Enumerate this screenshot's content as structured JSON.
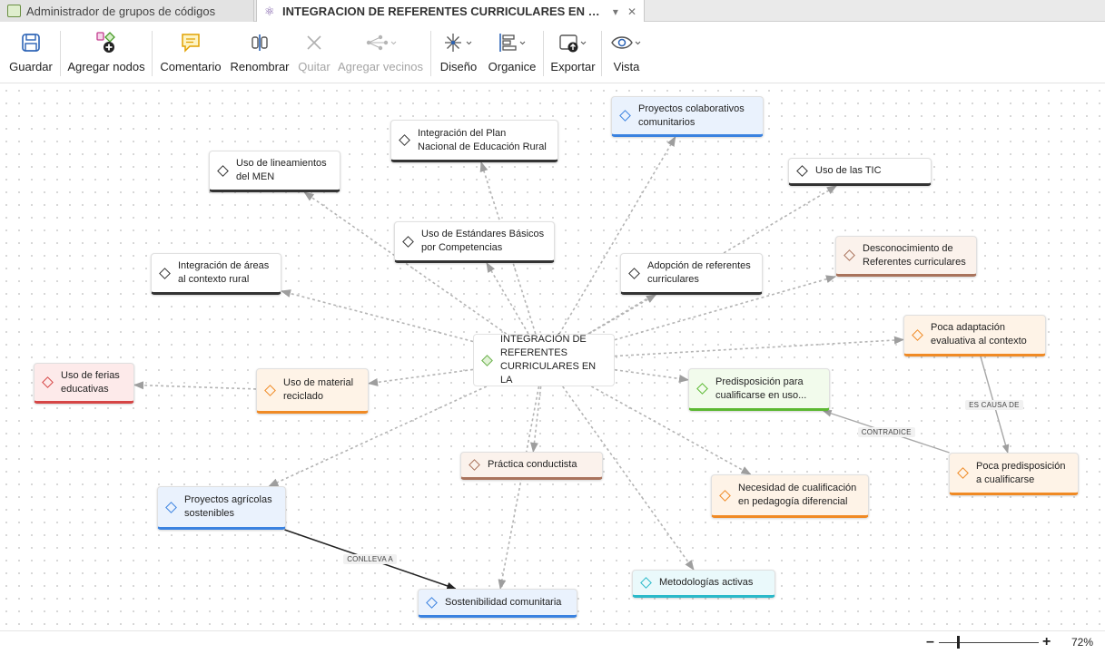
{
  "tabs": [
    {
      "label": "Administrador de grupos de códigos",
      "active": false
    },
    {
      "label": "INTEGRACION DE REFERENTES CURRICULARES EN L...",
      "active": true
    }
  ],
  "toolbar": {
    "save": "Guardar",
    "add_nodes": "Agregar nodos",
    "comment": "Comentario",
    "rename": "Renombrar",
    "remove": "Quitar",
    "add_neighbors": "Agregar vecinos",
    "design": "Diseño",
    "organize": "Organice",
    "export": "Exportar",
    "view": "Vista"
  },
  "icons": {
    "save": "floppy-disk-icon",
    "add_nodes": "add-nodes-icon",
    "comment": "comment-bubble-icon",
    "rename": "rename-cursor-icon",
    "remove": "x-icon",
    "add_neighbors": "network-icon",
    "design": "snowflake-layout-icon",
    "organize": "align-icon",
    "export": "export-icon",
    "view": "eye-icon"
  },
  "colors": {
    "black": "#333333",
    "blue": "#3a82e0",
    "brown": "#a9735c",
    "orange": "#f08a24",
    "red": "#d64545",
    "green": "#5cb832",
    "cyan": "#2ab9c9",
    "blue_bg": "#eaf2fd",
    "red_bg": "#fdeaea",
    "orange_bg": "#fef3e7",
    "brown_bg": "#fbf2ec",
    "green_bg": "#f2fbec",
    "cyan_bg": "#eaf9fb",
    "core_diamond": "#6ab04c"
  },
  "graph": {
    "nodes": [
      {
        "id": "core",
        "lines": [
          "INTEGRACIÓN DE",
          "REFERENTES",
          "CURRICULARES EN LA"
        ],
        "color": "core"
      },
      {
        "id": "plan",
        "lines": [
          "Integración del Plan",
          "Nacional de Educación Rural"
        ],
        "color": "black"
      },
      {
        "id": "proy_col",
        "lines": [
          "Proyectos colaborativos",
          "comunitarios"
        ],
        "color": "blue"
      },
      {
        "id": "lin_men",
        "lines": [
          "Uso de lineamientos",
          "del MEN"
        ],
        "color": "black"
      },
      {
        "id": "tic",
        "lines": [
          "Uso de las TIC"
        ],
        "color": "black"
      },
      {
        "id": "estandares",
        "lines": [
          "Uso de Estándares Básicos",
          "por Competencias"
        ],
        "color": "black"
      },
      {
        "id": "desconoc",
        "lines": [
          "Desconocimiento de",
          "Referentes curriculares"
        ],
        "color": "brown"
      },
      {
        "id": "integ_areas",
        "lines": [
          "Integración de áreas",
          "al contexto rural"
        ],
        "color": "black"
      },
      {
        "id": "adopcion",
        "lines": [
          "Adopción de referentes",
          "curriculares"
        ],
        "color": "black"
      },
      {
        "id": "poca_adapt",
        "lines": [
          "Poca adaptación",
          "evaluativa al contexto"
        ],
        "color": "orange"
      },
      {
        "id": "ferias",
        "lines": [
          "Uso de ferias",
          "educativas"
        ],
        "color": "red"
      },
      {
        "id": "material",
        "lines": [
          "Uso de material",
          "reciclado"
        ],
        "color": "orange"
      },
      {
        "id": "predisp",
        "lines": [
          "Predisposición para",
          "cualificarse en uso..."
        ],
        "color": "green"
      },
      {
        "id": "conductista",
        "lines": [
          "Práctica conductista"
        ],
        "color": "brown"
      },
      {
        "id": "poca_predisp",
        "lines": [
          "Poca predisposición",
          "a cualificarse"
        ],
        "color": "orange"
      },
      {
        "id": "necesidad",
        "lines": [
          "Necesidad de cualificación",
          "en pedagogía diferencial"
        ],
        "color": "orange"
      },
      {
        "id": "agricolas",
        "lines": [
          "Proyectos agrícolas",
          "sostenibles"
        ],
        "color": "blue"
      },
      {
        "id": "metodologias",
        "lines": [
          "Metodologías activas"
        ],
        "color": "cyan"
      },
      {
        "id": "sostenibilidad",
        "lines": [
          "Sostenibilidad comunitaria"
        ],
        "color": "blue"
      }
    ],
    "edges": [
      {
        "from": "core",
        "to": "plan",
        "style": "dashed"
      },
      {
        "from": "core",
        "to": "proy_col",
        "style": "dashed"
      },
      {
        "from": "core",
        "to": "lin_men",
        "style": "dashed"
      },
      {
        "from": "core",
        "to": "tic",
        "style": "dashed"
      },
      {
        "from": "core",
        "to": "estandares",
        "style": "dashed"
      },
      {
        "from": "core",
        "to": "desconoc",
        "style": "dashed"
      },
      {
        "from": "core",
        "to": "integ_areas",
        "style": "dashed"
      },
      {
        "from": "core",
        "to": "adopcion",
        "style": "dashed"
      },
      {
        "from": "core",
        "to": "poca_adapt",
        "style": "dashed"
      },
      {
        "from": "core",
        "to": "material",
        "style": "dashed"
      },
      {
        "from": "material",
        "to": "ferias",
        "style": "dashed"
      },
      {
        "from": "core",
        "to": "predisp",
        "style": "dashed"
      },
      {
        "from": "core",
        "to": "conductista",
        "style": "dashed"
      },
      {
        "from": "core",
        "to": "sostenibilidad",
        "style": "dashed"
      },
      {
        "from": "core",
        "to": "necesidad",
        "style": "dashed"
      },
      {
        "from": "core",
        "to": "agricolas",
        "style": "dashed"
      },
      {
        "from": "core",
        "to": "metodologias",
        "style": "dashed"
      },
      {
        "from": "poca_adapt",
        "to": "poca_predisp",
        "style": "solid-light",
        "label": "ES CAUSA DE"
      },
      {
        "from": "poca_predisp",
        "to": "predisp",
        "style": "solid-light",
        "label": "CONTRADICE"
      },
      {
        "from": "agricolas",
        "to": "sostenibilidad",
        "style": "solid-dark",
        "label": "CONLLEVA A"
      }
    ]
  },
  "zoom": {
    "minus": "–",
    "plus": "+",
    "level": "72%",
    "fraction": 0.18
  }
}
